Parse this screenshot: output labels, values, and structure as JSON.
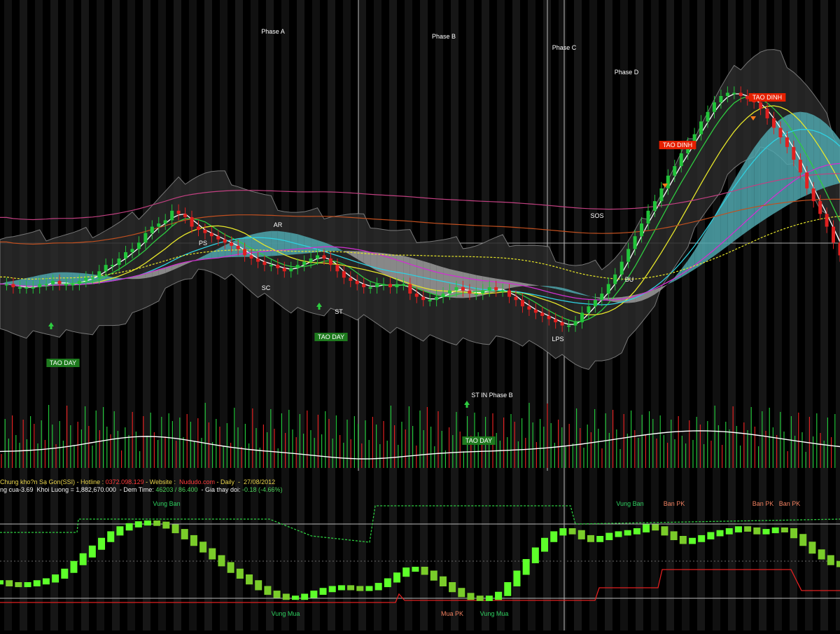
{
  "chart_data": {
    "type": "line",
    "x_description": "",
    "candles": [
      1,
      1,
      0,
      0,
      0,
      0,
      1,
      1,
      2,
      1,
      1,
      1,
      2,
      3,
      3,
      5,
      7,
      7,
      9,
      11,
      12,
      14,
      17,
      19,
      20,
      21,
      24,
      23,
      22,
      19,
      18,
      17,
      16,
      15,
      14,
      13,
      12,
      10,
      9,
      8,
      7,
      7,
      6,
      5,
      6,
      7,
      8,
      9,
      10,
      9,
      7,
      5,
      3,
      2,
      1,
      0,
      0,
      1,
      1,
      0,
      1,
      1,
      -2,
      -3,
      -4,
      -4,
      -3,
      -2,
      -1,
      0,
      -1,
      -2,
      -2,
      -1,
      0,
      -1,
      -1,
      -3,
      -4,
      -6,
      -7,
      -8,
      -9,
      -10,
      -11,
      -12,
      -12,
      -11,
      -8,
      -6,
      -4,
      -2,
      1,
      4,
      8,
      12,
      16,
      20,
      24,
      27,
      31,
      35,
      38,
      42,
      45,
      48,
      52,
      55,
      58,
      60,
      61,
      61,
      60,
      59,
      58,
      56,
      53,
      50,
      47,
      44,
      40,
      36,
      31,
      27,
      23,
      19,
      14,
      10
    ],
    "phases": [
      "Phase A",
      "Phase B",
      "Phase C",
      "Phase D"
    ],
    "wyckoff_labels": [
      "PS",
      "AR",
      "SC",
      "ST",
      "ST IN Phase B",
      "LPS",
      "SOS",
      "BU"
    ],
    "signals_bottom": [
      "TAO DAY",
      "TAO DAY",
      "TAO DAY"
    ],
    "signals_top": [
      "TAO DINH",
      "TAO DINH"
    ],
    "oscillator_labels": {
      "vung_ban": [
        "Vung Ban",
        "Vung Ban"
      ],
      "vung_mua": [
        "Vung Mua",
        "Vung Mua"
      ],
      "ban_pk": [
        "Ban PK",
        "Ban PK",
        "Ban PK"
      ],
      "mua_pk": [
        "Mua PK"
      ]
    },
    "oscillator": [
      -0.55,
      -0.6,
      -0.62,
      -0.6,
      -0.55,
      -0.5,
      -0.4,
      -0.25,
      -0.05,
      0.15,
      0.35,
      0.55,
      0.72,
      0.85,
      0.93,
      0.98,
      1.0,
      0.97,
      0.9,
      0.78,
      0.62,
      0.45,
      0.28,
      0.1,
      -0.08,
      -0.25,
      -0.4,
      -0.55,
      -0.7,
      -0.82,
      -0.9,
      -0.95,
      -0.95,
      -0.9,
      -0.82,
      -0.75,
      -0.7,
      -0.68,
      -0.7,
      -0.72,
      -0.7,
      -0.62,
      -0.5,
      -0.35,
      -0.22,
      -0.2,
      -0.3,
      -0.45,
      -0.6,
      -0.75,
      -0.88,
      -0.95,
      -0.98,
      -0.95,
      -0.85,
      -0.6,
      -0.3,
      0.0,
      0.3,
      0.55,
      0.72,
      0.8,
      0.75,
      0.62,
      0.55,
      0.6,
      0.68,
      0.72,
      0.75,
      0.8,
      0.9,
      0.85,
      0.72,
      0.6,
      0.5,
      0.55,
      0.62,
      0.7,
      0.75,
      0.8,
      0.85,
      0.82,
      0.75,
      0.78,
      0.82,
      0.8,
      0.65,
      0.45,
      0.25,
      0.1,
      -0.05,
      -0.1
    ]
  },
  "header": {
    "line1": [
      {
        "text": "Chung kho?n Sạ Gon(SSI) - Hotline : ",
        "color": "#e8d34a"
      },
      {
        "text": "0372.098.129",
        "color": "#ff3b3b"
      },
      {
        "text": " - Website : ",
        "color": "#e8d34a"
      },
      {
        "text": " Nududo.com",
        "color": "#ff3b3b"
      },
      {
        "text": " - Daily  -  27/08/2012",
        "color": "#e8d34a"
      }
    ],
    "line2": [
      {
        "text": "ng cua-3.69  Khoi Luong = 1,882,670.000  - Dem Time: ",
        "color": "#f2f2f2"
      },
      {
        "text": "46203 / 86.400",
        "color": "#4cd25a"
      },
      {
        "text": "  - Gia thay doi: ",
        "color": "#f2f2f2"
      },
      {
        "text": "-0.18 (-4.66%)",
        "color": "#4cd25a"
      }
    ]
  },
  "colors": {
    "up": "#22c43a",
    "down": "#e02020",
    "signal_green_bg": "#1e7a1e",
    "signal_red_bg": "#e62000",
    "ichimoku_up": "#4fa6ad",
    "ichimoku_down": "#9a9a9a"
  }
}
